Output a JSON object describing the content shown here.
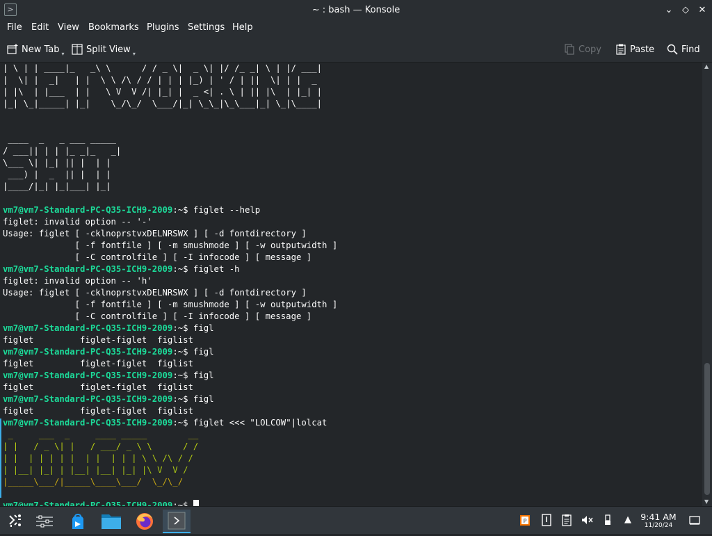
{
  "window": {
    "title": "~ : bash — Konsole",
    "buttons": {
      "minimize": "⌄",
      "maximize": "◇",
      "close": "✕"
    }
  },
  "menu": [
    "File",
    "Edit",
    "View",
    "Bookmarks",
    "Plugins",
    "Settings",
    "Help"
  ],
  "toolbar": {
    "new_tab": "New Tab",
    "split_view": "Split View",
    "copy": "Copy",
    "paste": "Paste",
    "find": "Find"
  },
  "terminal": {
    "prompt": "vm7@vm7-Standard-PC-Q35-ICH9-2009",
    "prompt_suffix": ":~$ ",
    "colors": {
      "prompt": "#1cdc9a",
      "text": "#fcfcfc",
      "background": "#232629"
    },
    "art_top": [
      "| \\ | | ____|_   _\\ \\      / / _ \\|  _ \\| |/ /_ _| \\ | |/ ___|",
      "|  \\| |  _|   | |  \\ \\ /\\ / / | | | |_) | ' / | ||  \\| | |  _",
      "| |\\  | |___  | |   \\ V  V /| |_| |  _ <| . \\ | || |\\  | |_| |",
      "|_| \\_|_____| |_|    \\_/\\_/  \\___/|_| \\_\\_|\\_\\___|_| \\_|\\____|"
    ],
    "art_shit": [
      " ____  _   _ ___ _____",
      "/ ___|| | | |_ _|_   _|",
      "\\___ \\| |_| || |  | |",
      " ___) |  _  || |  | |",
      "|____/|_| |_|___| |_|"
    ],
    "block1_cmd": "figlet --help",
    "block1_out": [
      "figlet: invalid option -- '-'",
      "Usage: figlet [ -cklnoprstvxDELNRSWX ] [ -d fontdirectory ]",
      "              [ -f fontfile ] [ -m smushmode ] [ -w outputwidth ]",
      "              [ -C controlfile ] [ -I infocode ] [ message ]"
    ],
    "block2_cmd": "figlet -h",
    "block2_out": [
      "figlet: invalid option -- 'h'",
      "Usage: figlet [ -cklnoprstvxDELNRSWX ] [ -d fontdirectory ]",
      "              [ -f fontfile ] [ -m smushmode ] [ -w outputwidth ]",
      "              [ -C controlfile ] [ -I infocode ] [ message ]"
    ],
    "figl_cmd": "figl",
    "figl_out": "figlet         figlet-figlet  figlist",
    "lolcat_cmd": "figlet <<< \"LOLCOW\"|lolcat",
    "lolcat_lines": [
      [
        [
          "#c9c60e",
          " _     ___  _     ____ _____        __"
        ]
      ],
      [
        [
          "#b8cd12",
          "| |   / _ \\| |   / ___/ _ \\ \\      / /"
        ]
      ],
      [
        [
          "#b0c813",
          "| |  | | | | |  | |  | | | \\ \\ /\\ / /"
        ]
      ],
      [
        [
          "#a9c516",
          "| |__| |_| | |__| |__| |_| |\\ V  V /"
        ]
      ],
      [
        [
          "#c8a813",
          "|_____\\___/|_____\\____\\___/  \\_/\\_/"
        ]
      ]
    ]
  },
  "taskbar": {
    "apps": [
      "application-launcher-icon",
      "system-settings-icon",
      "discover-store-icon",
      "file-manager-icon",
      "firefox-icon",
      "konsole-icon"
    ],
    "clock": {
      "time": "9:41 AM",
      "date": "11/20/24"
    }
  }
}
